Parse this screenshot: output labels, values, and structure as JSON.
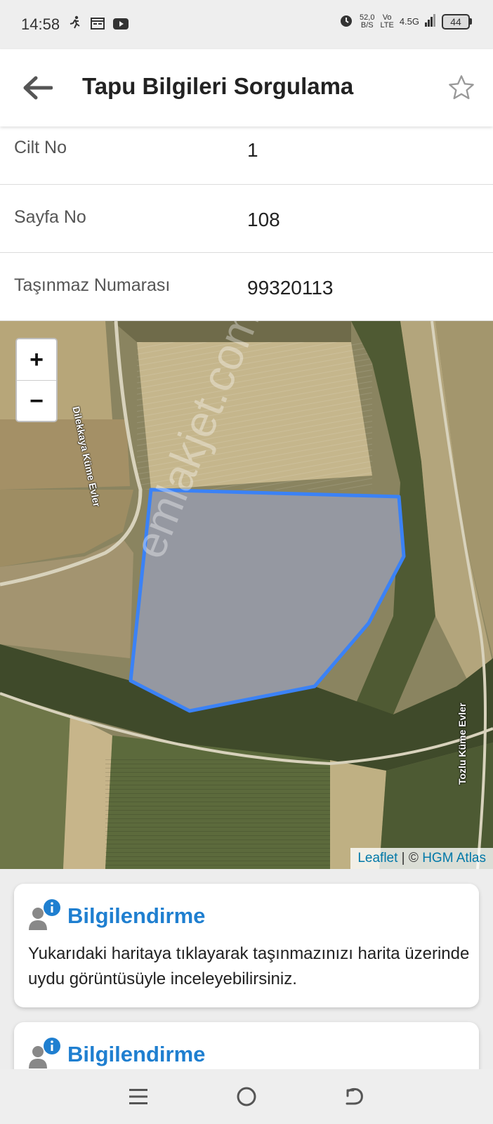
{
  "status_bar": {
    "time": "14:58",
    "net_speed_value": "52,0",
    "net_speed_unit": "B/S",
    "volte_top": "Vo",
    "volte_bottom": "LTE",
    "network_type": "4.5G",
    "battery": "44"
  },
  "app_bar": {
    "title": "Tapu Bilgileri Sorgulama",
    "back_icon": "arrow-left-icon",
    "favorite_icon": "star-outline-icon"
  },
  "info_rows": [
    {
      "label": "Cilt No",
      "value": "1"
    },
    {
      "label": "Sayfa No",
      "value": "108"
    },
    {
      "label": "Taşınmaz Numarası",
      "value": "99320113"
    }
  ],
  "map": {
    "zoom_in": "+",
    "zoom_out": "−",
    "attribution_leaflet": "Leaflet",
    "attribution_sep": " | © ",
    "attribution_source": "HGM Atlas",
    "road_label_left": "Dilekkaya Küme Evler",
    "road_label_right": "Tozlu Küme Evler",
    "watermark": "emlakjet.com",
    "parcel_color": "#3b82f6"
  },
  "cards": [
    {
      "title": "Bilgilendirme",
      "text": "Yukarıdaki haritaya tıklayarak taşınmazınızı harita üzerinde uydu görüntüsüyle inceleyebilirsiniz."
    },
    {
      "title": "Bilgilendirme",
      "text": ""
    }
  ],
  "nav_bar": {
    "menu_icon": "menu-icon",
    "home_icon": "home-circle-icon",
    "back_icon": "back-arrow-icon"
  },
  "colors": {
    "accent": "#1f7fd0",
    "parcel_outline": "#3b82f6"
  }
}
